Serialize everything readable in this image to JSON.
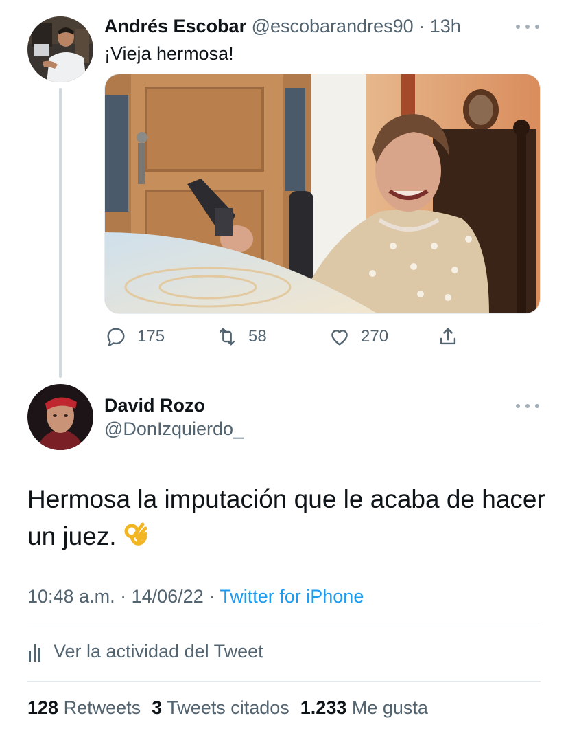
{
  "parent_tweet": {
    "author_name": "Andrés Escobar",
    "author_handle": "@escobarandres90",
    "separator": "·",
    "time": "13h",
    "text": "¡Vieja hermosa!",
    "replies": "175",
    "retweets": "58",
    "likes": "270"
  },
  "reply_tweet": {
    "author_name": "David Rozo",
    "author_handle": "@DonIzquierdo_",
    "text": "Hermosa la imputación que le acaba de hacer un juez.",
    "emoji": "ok-hand-emoji",
    "time": "10:48 a.m.",
    "date": "14/06/22",
    "separator": "·",
    "source": "Twitter for iPhone"
  },
  "activity": {
    "label": "Ver la actividad del Tweet"
  },
  "stats": {
    "retweets_count": "128",
    "retweets_label": "Retweets",
    "quotes_count": "3",
    "quotes_label": "Tweets citados",
    "likes_count": "1.233",
    "likes_label": "Me gusta"
  },
  "icons": {
    "reply": "reply-icon",
    "retweet": "retweet-icon",
    "like": "heart-icon",
    "share": "share-icon",
    "more": "more-icon",
    "activity": "bar-chart-icon"
  },
  "colors": {
    "text_primary": "#0f1419",
    "text_secondary": "#536471",
    "link": "#1d9bf0",
    "thread_line": "#cfd9de"
  }
}
